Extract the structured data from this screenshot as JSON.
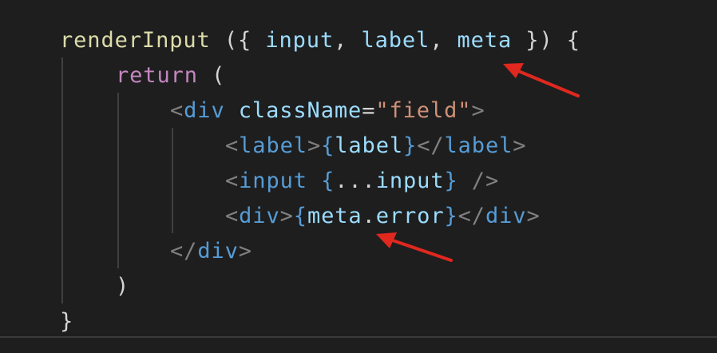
{
  "colors": {
    "background": "#1e1e1e",
    "function": "#dcdcaa",
    "keyword_control": "#c586c0",
    "variable": "#9cdcfe",
    "tag": "#569cd6",
    "tag_bracket": "#808080",
    "string": "#ce9178",
    "punctuation": "#d4d4d4",
    "annotation_arrow": "#e0281f"
  },
  "code": {
    "lines": [
      {
        "indent": 75,
        "tokens": [
          {
            "text": "renderInput",
            "kind": "function"
          },
          {
            "text": " ({ ",
            "kind": "punctuation"
          },
          {
            "text": "input",
            "kind": "variable"
          },
          {
            "text": ", ",
            "kind": "punctuation"
          },
          {
            "text": "label",
            "kind": "variable"
          },
          {
            "text": ", ",
            "kind": "punctuation"
          },
          {
            "text": "meta",
            "kind": "variable"
          },
          {
            "text": " }) {",
            "kind": "punctuation"
          }
        ]
      },
      {
        "indent": 145,
        "tokens": [
          {
            "text": "return",
            "kind": "keyword_control"
          },
          {
            "text": " (",
            "kind": "punctuation"
          }
        ]
      },
      {
        "indent": 213,
        "tokens": [
          {
            "text": "<",
            "kind": "tag_bracket"
          },
          {
            "text": "div",
            "kind": "tag"
          },
          {
            "text": " ",
            "kind": "punctuation"
          },
          {
            "text": "className",
            "kind": "variable"
          },
          {
            "text": "=",
            "kind": "punctuation"
          },
          {
            "text": "\"field\"",
            "kind": "string"
          },
          {
            "text": ">",
            "kind": "tag_bracket"
          }
        ]
      },
      {
        "indent": 282,
        "tokens": [
          {
            "text": "<",
            "kind": "tag_bracket"
          },
          {
            "text": "label",
            "kind": "tag"
          },
          {
            "text": ">",
            "kind": "tag_bracket"
          },
          {
            "text": "{",
            "kind": "tag"
          },
          {
            "text": "label",
            "kind": "variable"
          },
          {
            "text": "}",
            "kind": "tag"
          },
          {
            "text": "</",
            "kind": "tag_bracket"
          },
          {
            "text": "label",
            "kind": "tag"
          },
          {
            "text": ">",
            "kind": "tag_bracket"
          }
        ]
      },
      {
        "indent": 282,
        "tokens": [
          {
            "text": "<",
            "kind": "tag_bracket"
          },
          {
            "text": "input",
            "kind": "tag"
          },
          {
            "text": " ",
            "kind": "punctuation"
          },
          {
            "text": "{",
            "kind": "tag"
          },
          {
            "text": "...",
            "kind": "punctuation"
          },
          {
            "text": "input",
            "kind": "variable"
          },
          {
            "text": "}",
            "kind": "tag"
          },
          {
            "text": " />",
            "kind": "tag_bracket"
          }
        ]
      },
      {
        "indent": 282,
        "tokens": [
          {
            "text": "<",
            "kind": "tag_bracket"
          },
          {
            "text": "div",
            "kind": "tag"
          },
          {
            "text": ">",
            "kind": "tag_bracket"
          },
          {
            "text": "{",
            "kind": "tag"
          },
          {
            "text": "meta",
            "kind": "variable"
          },
          {
            "text": ".",
            "kind": "punctuation"
          },
          {
            "text": "error",
            "kind": "variable"
          },
          {
            "text": "}",
            "kind": "tag"
          },
          {
            "text": "</",
            "kind": "tag_bracket"
          },
          {
            "text": "div",
            "kind": "tag"
          },
          {
            "text": ">",
            "kind": "tag_bracket"
          }
        ]
      },
      {
        "indent": 213,
        "tokens": [
          {
            "text": "</",
            "kind": "tag_bracket"
          },
          {
            "text": "div",
            "kind": "tag"
          },
          {
            "text": ">",
            "kind": "tag_bracket"
          }
        ]
      },
      {
        "indent": 145,
        "tokens": [
          {
            "text": ")",
            "kind": "punctuation"
          }
        ]
      },
      {
        "indent": 75,
        "tokens": [
          {
            "text": "}",
            "kind": "punctuation"
          }
        ]
      }
    ]
  },
  "annotations": [
    {
      "name": "arrow-to-meta-param",
      "points_to": "meta",
      "line": 1
    },
    {
      "name": "arrow-to-meta-error",
      "points_to": "meta.error",
      "line": 6
    }
  ]
}
